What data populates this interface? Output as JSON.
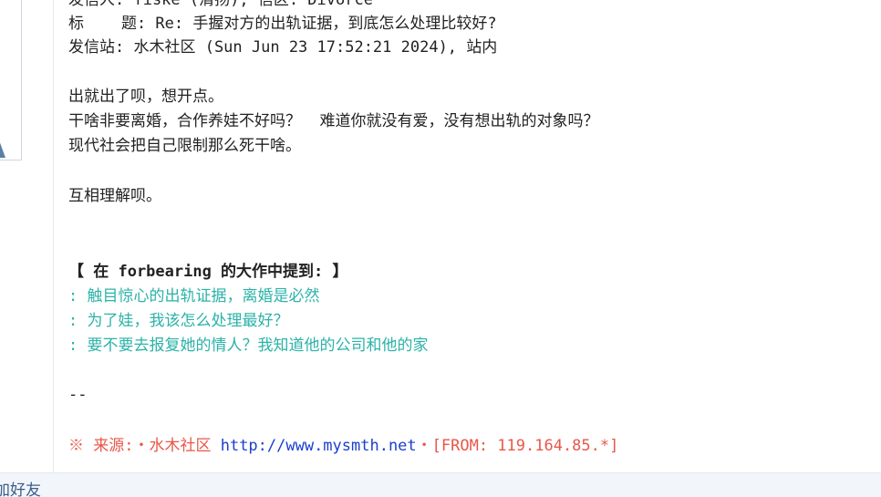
{
  "header": {
    "sender_line": "发信人: fiske (清扬), 信区: Divorce",
    "title_line": "标    题: Re: 手握对方的出轨证据，到底怎么处理比较好?",
    "station_line": "发信站: 水木社区 (Sun Jun 23 17:52:21 2024), 站内"
  },
  "body": {
    "paragraph1": [
      "出就出了呗，想开点。",
      "干啥非要离婚，合作养娃不好吗？  难道你就没有爱，没有想出轨的对象吗？",
      "现代社会把自己限制那么死干啥。"
    ],
    "paragraph2": "互相理解呗。"
  },
  "quote": {
    "header": "【 在 forbearing 的大作中提到: 】",
    "lines": [
      ": 触目惊心的出轨证据，离婚是必然",
      ": 为了娃，我该怎么处理最好？",
      ": 要不要去报复她的情人？我知道他的公司和他的家"
    ]
  },
  "signature": {
    "separator": "--"
  },
  "source": {
    "prefix": "※ 来源:・水木社区 ",
    "url": "http://www.mysmth.net",
    "suffix": "・[FROM: 119.164.85.*]"
  },
  "sidebar": {
    "add_friend_label": "加好友"
  },
  "colors": {
    "quote": "#2bb3a8",
    "source": "#e8574b",
    "link": "#1b3fcf"
  }
}
